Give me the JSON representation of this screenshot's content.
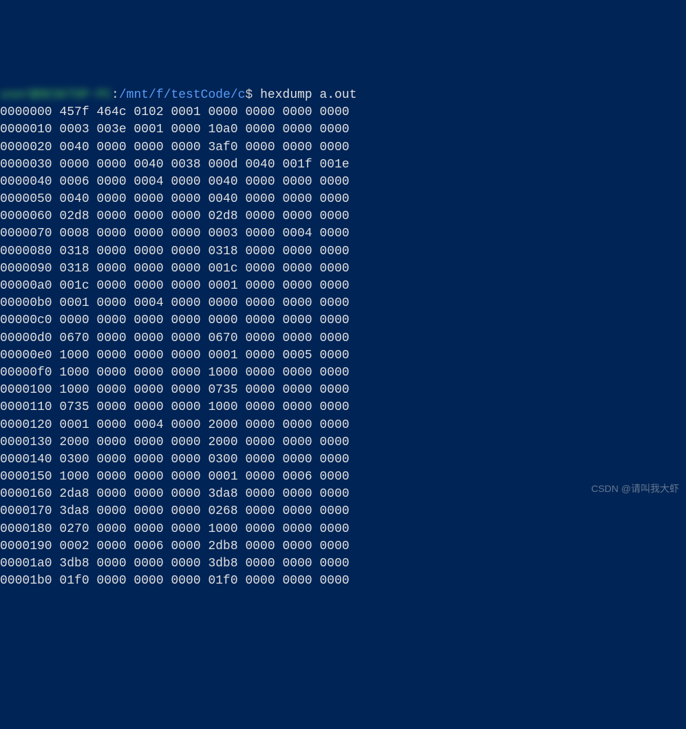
{
  "prompt": {
    "user_host": "user@DESKTOP-PC",
    "separator": ":",
    "path": "/mnt/f/testCode/c",
    "dollar": "$",
    "command": "hexdump a.out"
  },
  "hexdump": [
    "0000000 457f 464c 0102 0001 0000 0000 0000 0000",
    "0000010 0003 003e 0001 0000 10a0 0000 0000 0000",
    "0000020 0040 0000 0000 0000 3af0 0000 0000 0000",
    "0000030 0000 0000 0040 0038 000d 0040 001f 001e",
    "0000040 0006 0000 0004 0000 0040 0000 0000 0000",
    "0000050 0040 0000 0000 0000 0040 0000 0000 0000",
    "0000060 02d8 0000 0000 0000 02d8 0000 0000 0000",
    "0000070 0008 0000 0000 0000 0003 0000 0004 0000",
    "0000080 0318 0000 0000 0000 0318 0000 0000 0000",
    "0000090 0318 0000 0000 0000 001c 0000 0000 0000",
    "00000a0 001c 0000 0000 0000 0001 0000 0000 0000",
    "00000b0 0001 0000 0004 0000 0000 0000 0000 0000",
    "00000c0 0000 0000 0000 0000 0000 0000 0000 0000",
    "00000d0 0670 0000 0000 0000 0670 0000 0000 0000",
    "00000e0 1000 0000 0000 0000 0001 0000 0005 0000",
    "00000f0 1000 0000 0000 0000 1000 0000 0000 0000",
    "0000100 1000 0000 0000 0000 0735 0000 0000 0000",
    "0000110 0735 0000 0000 0000 1000 0000 0000 0000",
    "0000120 0001 0000 0004 0000 2000 0000 0000 0000",
    "0000130 2000 0000 0000 0000 2000 0000 0000 0000",
    "0000140 0300 0000 0000 0000 0300 0000 0000 0000",
    "0000150 1000 0000 0000 0000 0001 0000 0006 0000",
    "0000160 2da8 0000 0000 0000 3da8 0000 0000 0000",
    "0000170 3da8 0000 0000 0000 0268 0000 0000 0000",
    "0000180 0270 0000 0000 0000 1000 0000 0000 0000",
    "0000190 0002 0000 0006 0000 2db8 0000 0000 0000",
    "00001a0 3db8 0000 0000 0000 3db8 0000 0000 0000",
    "00001b0 01f0 0000 0000 0000 01f0 0000 0000 0000"
  ],
  "watermark": "CSDN @请叫我大虾"
}
